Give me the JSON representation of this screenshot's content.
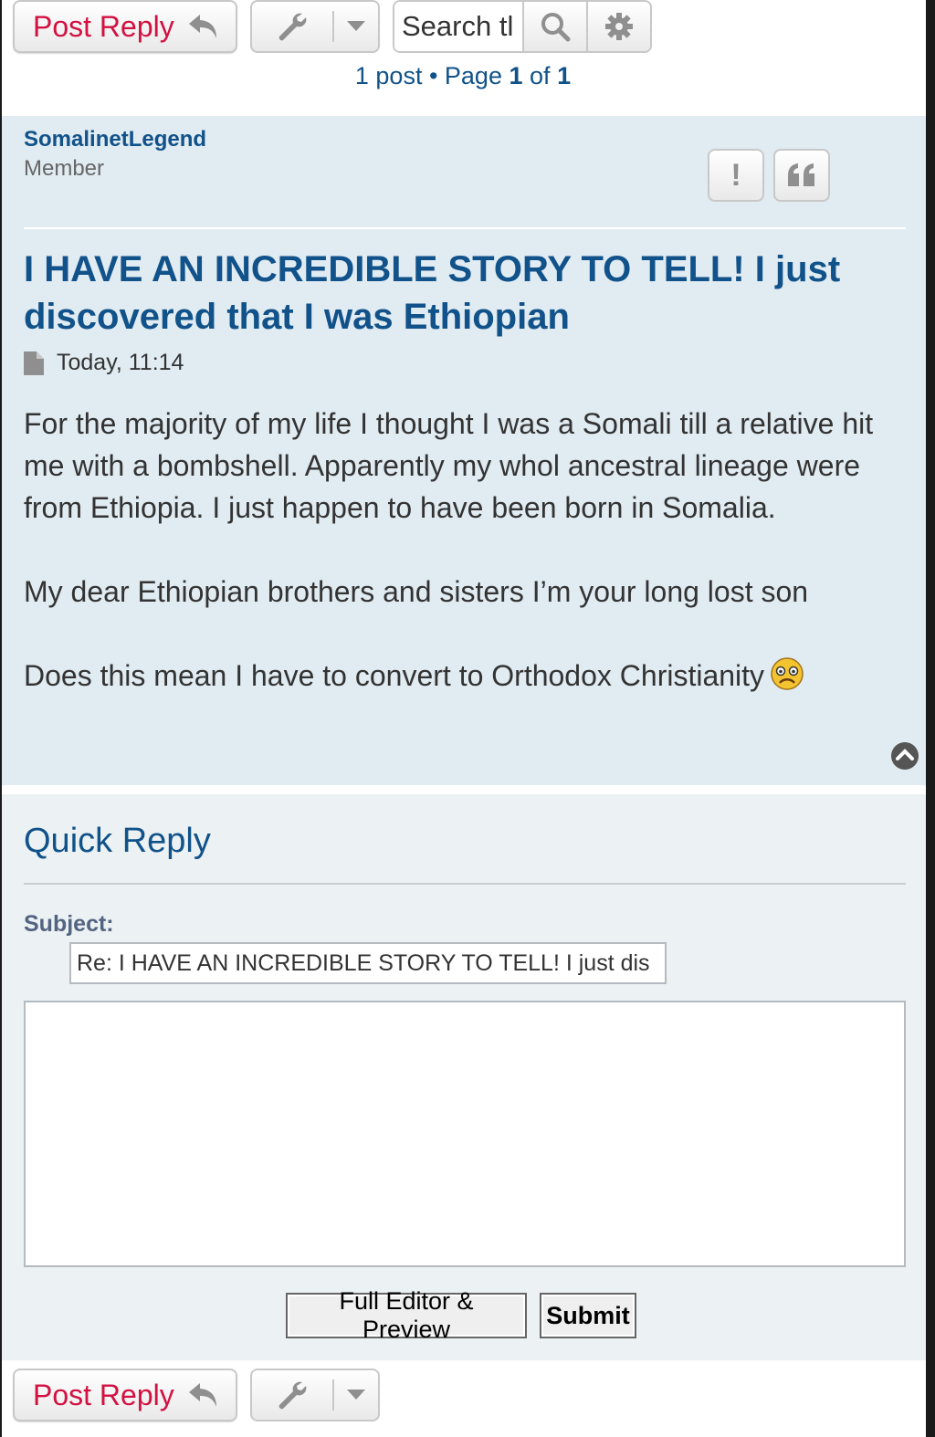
{
  "actions": {
    "post_reply_label": "Post Reply",
    "search_placeholder": "Search tl"
  },
  "pagination": {
    "post_count_text": "1 post • Page",
    "current_page": "1",
    "of_text": "of",
    "total_pages": "1"
  },
  "post": {
    "author": "SomalinetLegend",
    "rank": "Member",
    "report_label": "!",
    "title": "I HAVE AN INCREDIBLE STORY TO TELL! I just discovered that I was Ethiopian",
    "timestamp": "Today, 11:14",
    "paragraphs": [
      "For the majority of my life I thought I was a Somali till a relative hit me with a bombshell. Apparently my whol ancestral lineage were from Ethiopia. I just happen to have been born in Somalia.",
      "My dear Ethiopian brothers and sisters I’m your long lost son",
      "Does this mean I have to convert to Orthodox Christianity"
    ]
  },
  "quick_reply": {
    "title": "Quick Reply",
    "subject_label": "Subject:",
    "subject_value": "Re: I HAVE AN INCREDIBLE STORY TO TELL! I just dis",
    "full_editor_label": "Full Editor & Preview",
    "submit_label": "Submit"
  },
  "colors": {
    "link_blue": "#105289",
    "post_reply_red": "#d31141",
    "post_bg": "#e1ebf2",
    "quick_reply_bg": "#ecf1f3"
  },
  "icons": [
    "reply-arrow-icon",
    "wrench-icon",
    "caret-down-icon",
    "search-icon",
    "gear-icon",
    "post-file-icon",
    "quote-icon",
    "frowning-emoji-icon",
    "chevron-up-icon"
  ]
}
